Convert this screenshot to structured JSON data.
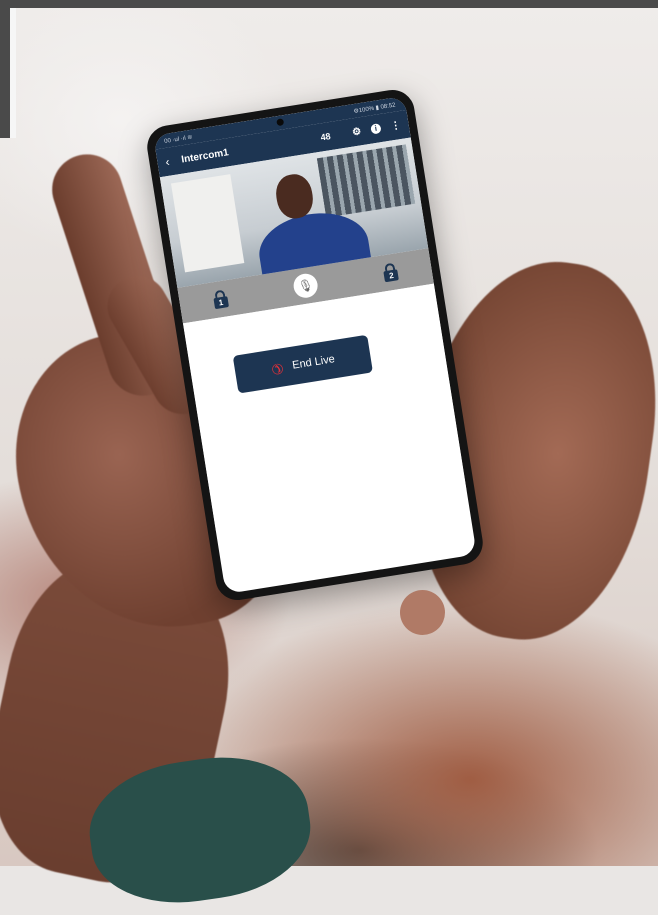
{
  "status_bar": {
    "left": "00 ·ul ·ıl ≋",
    "right": "⚙100% ▮ 08:52"
  },
  "header": {
    "back_glyph": "‹",
    "title": "Intercom1",
    "count": "48",
    "icons": [
      "gear-icon",
      "info-icon",
      "menu-icon"
    ]
  },
  "controls": {
    "lock1_label": "1",
    "lock2_label": "2",
    "mute_icon": "microphone-off-icon"
  },
  "call": {
    "end_button_label": "End Live",
    "end_icon": "phone-hangup-icon"
  },
  "colors": {
    "app_navy": "#1d3552",
    "control_gray": "#9a9a9a",
    "hangup_red": "#e0303a"
  }
}
